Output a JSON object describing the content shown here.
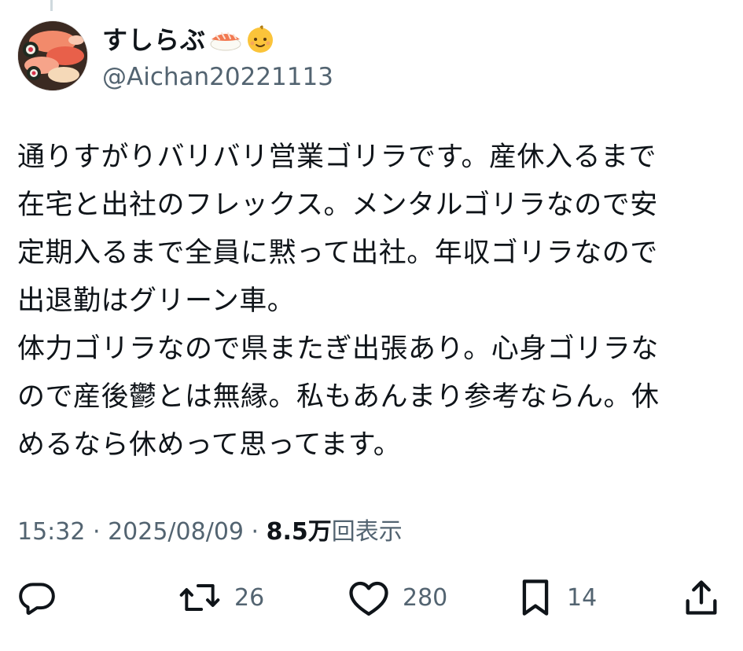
{
  "tweet": {
    "author": {
      "display_name": "すしらぶ",
      "display_name_emojis": [
        "sushi-emoji",
        "baby-emoji"
      ],
      "handle": "@Aichan20221113",
      "avatar_icon": "sushi-platter-avatar"
    },
    "body_lines": [
      "通りすがりバリバリ営業ゴリラです。産休入るまで",
      "在宅と出社のフレックス。メンタルゴリラなので安",
      "定期入るまで全員に黙って出社。年収ゴリラなので",
      "出退勤はグリーン車。",
      "体力ゴリラなので県またぎ出張あり。心身ゴリラな",
      "ので産後鬱とは無縁。私もあんまり参考ならん。休",
      "めるなら休めって思ってます。"
    ],
    "meta": {
      "time": "15:32",
      "separator": " · ",
      "date": "2025/08/09",
      "views_count": "8.5万",
      "views_label": "回表示"
    },
    "actions": {
      "reply": {
        "icon": "reply-icon",
        "count": ""
      },
      "retweet": {
        "icon": "retweet-icon",
        "count": "26"
      },
      "like": {
        "icon": "heart-icon",
        "count": "280"
      },
      "bookmark": {
        "icon": "bookmark-icon",
        "count": "14"
      },
      "share": {
        "icon": "share-icon",
        "count": ""
      }
    }
  },
  "colors": {
    "text_primary": "#0f1419",
    "text_secondary": "#536471",
    "thread_line": "#cfd9de"
  }
}
